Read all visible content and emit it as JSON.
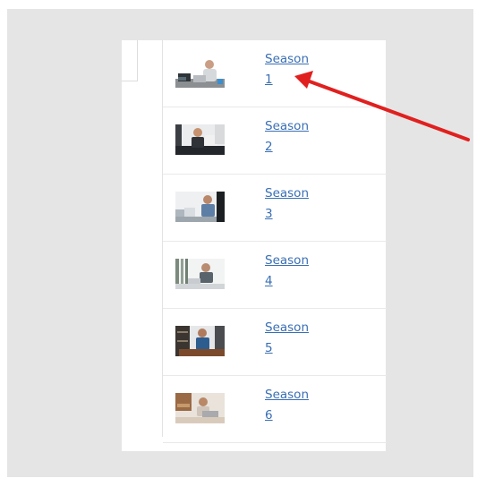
{
  "seasons": [
    {
      "word": "Season",
      "number": "1",
      "thumb": "person-laptop-desk-photo"
    },
    {
      "word": "Season",
      "number": "2",
      "thumb": "person-laptop-office-photo"
    },
    {
      "word": "Season",
      "number": "3",
      "thumb": "person-laptop-bright-photo"
    },
    {
      "word": "Season",
      "number": "4",
      "thumb": "person-laptop-window-photo"
    },
    {
      "word": "Season",
      "number": "5",
      "thumb": "person-laptop-shelf-photo"
    },
    {
      "word": "Season",
      "number": "6",
      "thumb": "person-laptop-warm-photo"
    }
  ],
  "colors": {
    "link": "#3a6fb4",
    "annotation_arrow": "#e0201f",
    "backdrop": "#e5e5e5"
  }
}
